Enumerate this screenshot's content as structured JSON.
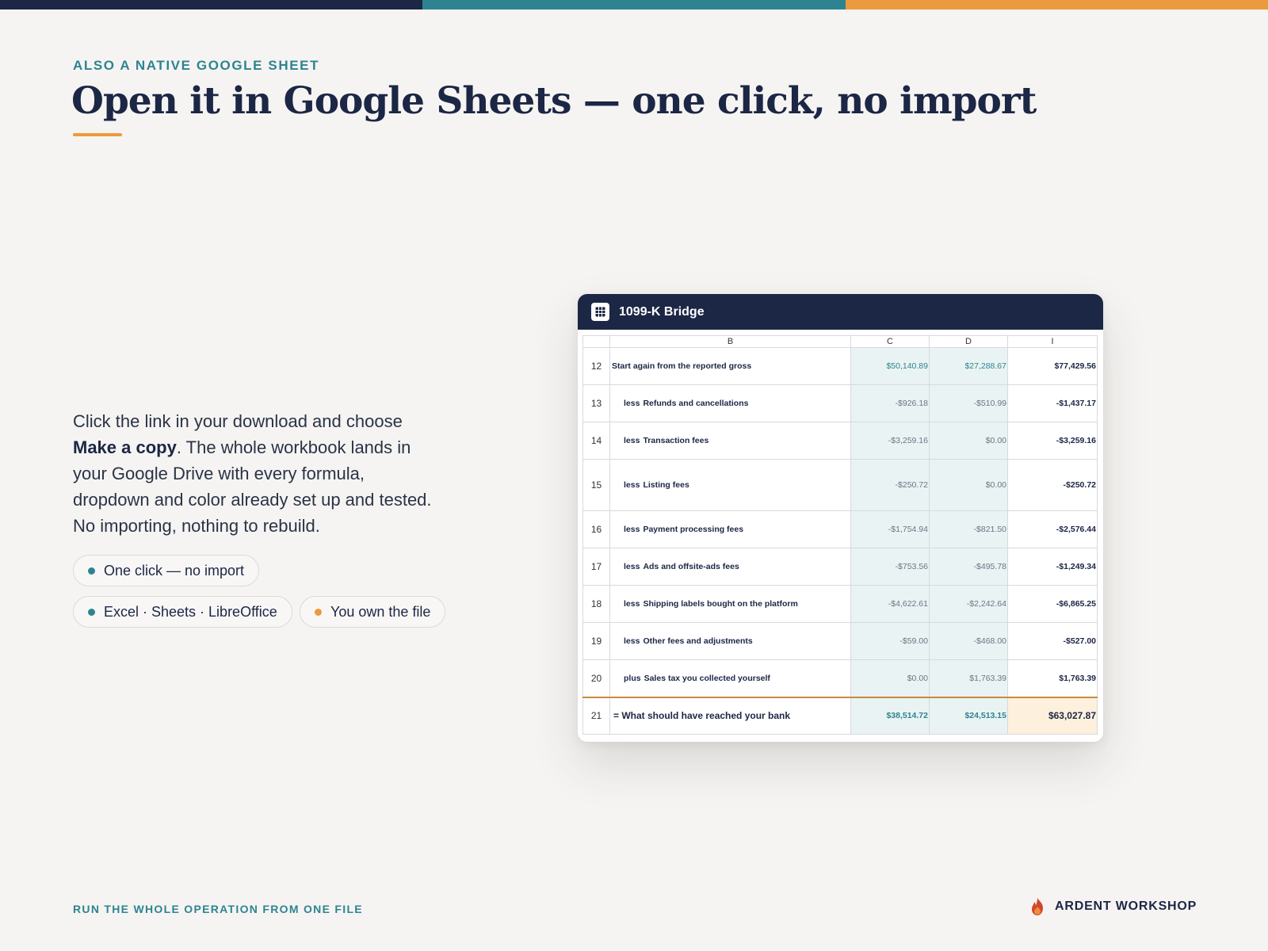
{
  "header": {
    "eyebrow": "ALSO A NATIVE GOOGLE SHEET",
    "title": "Open it in Google Sheets — one click, no import"
  },
  "body": {
    "part1": "Click the link in your download and choose ",
    "emphasis": "Make a copy",
    "part2": ". The whole workbook lands in your Google Drive with every formula, dropdown and color already set up and tested. No importing, nothing to rebuild."
  },
  "chips": [
    {
      "label": "One click — no import",
      "dot_color": "#2d8490"
    },
    {
      "label": "Excel · Sheets · LibreOffice",
      "dot_color": "#2d8490"
    },
    {
      "label": "You own the file",
      "dot_color": "#ec9a3e"
    }
  ],
  "sheet": {
    "title": "1099-K Bridge",
    "icon": "sheets-grid-icon",
    "columns": [
      "B",
      "C",
      "D",
      "I"
    ],
    "rows": [
      {
        "num": "12",
        "prefix": "",
        "label": "Start again from the reported gross",
        "c": "$50,140.89",
        "d": "$27,288.67",
        "i": "$77,429.56"
      },
      {
        "num": "13",
        "prefix": "less",
        "label": "Refunds and cancellations",
        "c": "-$926.18",
        "d": "-$510.99",
        "i": "-$1,437.17"
      },
      {
        "num": "14",
        "prefix": "less",
        "label": "Transaction fees",
        "c": "-$3,259.16",
        "d": "$0.00",
        "i": "-$3,259.16"
      },
      {
        "num": "15",
        "prefix": "less",
        "label": "Listing fees",
        "c": "-$250.72",
        "d": "$0.00",
        "i": "-$250.72"
      },
      {
        "num": "16",
        "prefix": "less",
        "label": "Payment processing fees",
        "c": "-$1,754.94",
        "d": "-$821.50",
        "i": "-$2,576.44"
      },
      {
        "num": "17",
        "prefix": "less",
        "label": "Ads and offsite-ads fees",
        "c": "-$753.56",
        "d": "-$495.78",
        "i": "-$1,249.34"
      },
      {
        "num": "18",
        "prefix": "less",
        "label": "Shipping labels bought on the platform",
        "c": "-$4,622.61",
        "d": "-$2,242.64",
        "i": "-$6,865.25"
      },
      {
        "num": "19",
        "prefix": "less",
        "label": "Other fees and adjustments",
        "c": "-$59.00",
        "d": "-$468.00",
        "i": "-$527.00"
      },
      {
        "num": "20",
        "prefix": "plus",
        "label": "Sales tax you collected yourself",
        "c": "$0.00",
        "d": "$1,763.39",
        "i": "$1,763.39"
      },
      {
        "num": "21",
        "prefix": "",
        "label": "= What should have reached your bank",
        "c": "$38,514.72",
        "d": "$24,513.15",
        "i": "$63,027.87"
      }
    ]
  },
  "footer": {
    "tagline": "RUN THE WHOLE OPERATION FROM ONE FILE",
    "brand": "ARDENT WORKSHOP",
    "brand_icon": "flame-logo-icon"
  },
  "colors": {
    "navy": "#1c2645",
    "teal": "#2d8490",
    "orange": "#ec9a3e",
    "background": "#f5f4f2"
  }
}
